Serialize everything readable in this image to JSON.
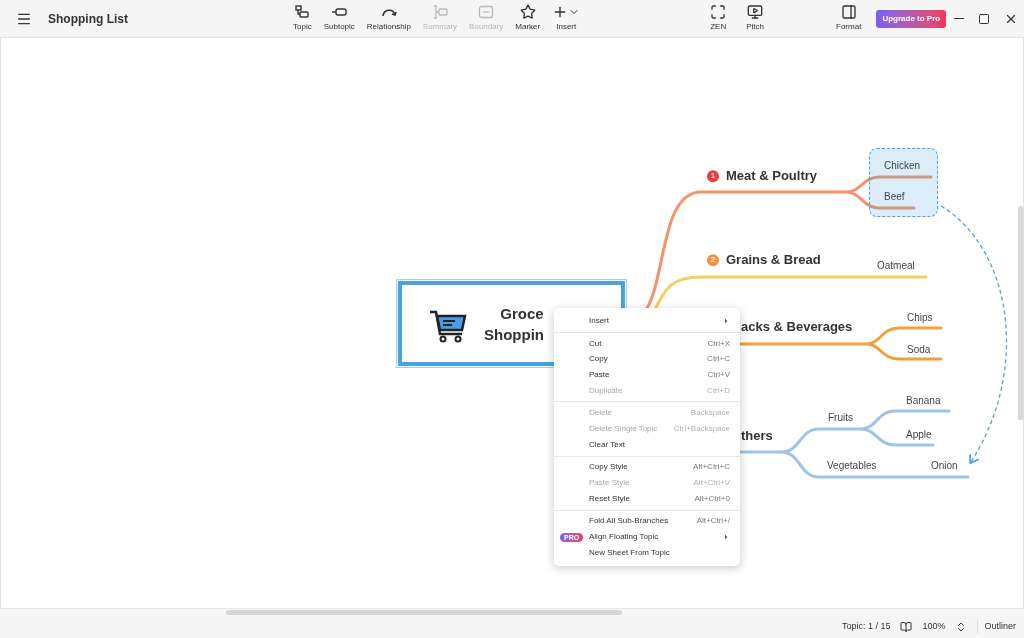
{
  "window": {
    "title": "Shopping List"
  },
  "toolbar": [
    {
      "label": "Topic",
      "disabled": false
    },
    {
      "label": "Subtopic",
      "disabled": false
    },
    {
      "label": "Relationship",
      "disabled": false
    },
    {
      "label": "Summary",
      "disabled": true
    },
    {
      "label": "Boundary",
      "disabled": true
    },
    {
      "label": "Marker",
      "disabled": false
    },
    {
      "label": "Insert",
      "disabled": false
    }
  ],
  "view_buttons": [
    {
      "label": "ZEN"
    },
    {
      "label": "Pitch"
    }
  ],
  "format_button": {
    "label": "Format"
  },
  "upgrade_button": {
    "label": "Upgrade to Pro"
  },
  "central_topic": {
    "lines": [
      "Groce",
      "Shoppin"
    ],
    "selected": true
  },
  "topics": [
    {
      "label": "Meat & Poultry",
      "color": "#f4936a",
      "marker": {
        "text": "1",
        "color": "#ee3b3b"
      },
      "boundary": true,
      "children": [
        {
          "label": "Chicken"
        },
        {
          "label": "Beef"
        }
      ]
    },
    {
      "label": "Grains & Bread",
      "color": "#f7cf5e",
      "marker": {
        "text": "2",
        "color": "#f7913a"
      },
      "boundary": false,
      "children": [
        {
          "label": "Oatmeal"
        }
      ]
    },
    {
      "label": "acks & Beverages",
      "color": "#f0a03c",
      "boundary": false,
      "children": [
        {
          "label": "Chips"
        },
        {
          "label": "Soda"
        }
      ]
    },
    {
      "label": "thers",
      "color": "#9dc3e8",
      "boundary": false,
      "children": [
        {
          "label": "Fruits",
          "children": [
            {
              "label": "Banana"
            },
            {
              "label": "Apple"
            }
          ]
        },
        {
          "label": "Vegetables",
          "children": [
            {
              "label": "Onion"
            }
          ]
        }
      ]
    }
  ],
  "context_menu": [
    [
      {
        "label": "Insert",
        "disabled": false,
        "submenu": true
      }
    ],
    [
      {
        "label": "Cut",
        "shortcut": "Ctrl+X",
        "disabled": false,
        "submenu": false
      },
      {
        "label": "Copy",
        "shortcut": "Ctrl+C",
        "disabled": false,
        "submenu": false
      },
      {
        "label": "Paste",
        "shortcut": "Ctrl+V",
        "disabled": false,
        "submenu": false
      },
      {
        "label": "Duplicate",
        "shortcut": "Ctrl+D",
        "disabled": true,
        "submenu": false
      }
    ],
    [
      {
        "label": "Delete",
        "shortcut": "Backspace",
        "disabled": true,
        "submenu": false
      },
      {
        "label": "Delete Single Topic",
        "shortcut": "Ctrl+Backspace",
        "disabled": true,
        "submenu": false
      },
      {
        "label": "Clear Text",
        "disabled": false,
        "submenu": false
      }
    ],
    [
      {
        "label": "Copy Style",
        "shortcut": "Alt+Ctrl+C",
        "disabled": false,
        "submenu": false
      },
      {
        "label": "Paste Style",
        "shortcut": "Alt+Ctrl+V",
        "disabled": true,
        "submenu": false
      },
      {
        "label": "Reset Style",
        "shortcut": "Alt+Ctrl+0",
        "disabled": false,
        "submenu": false
      }
    ],
    [
      {
        "label": "Fold All Sub-Branches",
        "shortcut": "Alt+Ctrl+/",
        "disabled": false,
        "submenu": false
      },
      {
        "label": "Align Floating Topic",
        "badge": "PRO",
        "disabled": false,
        "submenu": true
      },
      {
        "label": "New Sheet From Topic",
        "disabled": false,
        "submenu": false
      }
    ]
  ],
  "status_bar": {
    "topic_count": "Topic: 1 / 15",
    "zoom": "100%",
    "outliner": "Outliner"
  }
}
